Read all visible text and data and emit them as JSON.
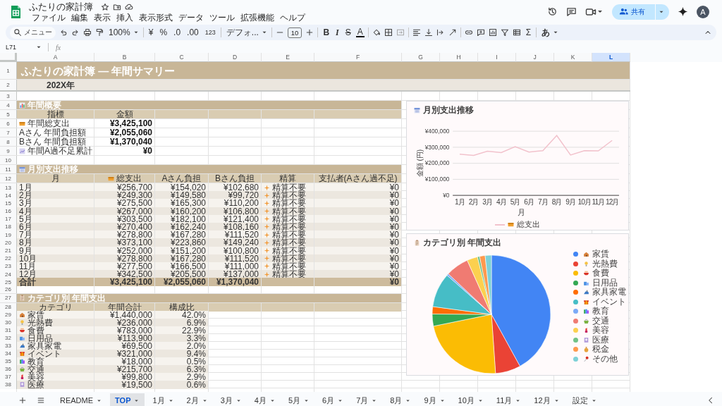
{
  "app": {
    "title": "ふたりの家計簿",
    "menu": [
      "ファイル",
      "編集",
      "表示",
      "挿入",
      "表示形式",
      "データ",
      "ツール",
      "拡張機能",
      "ヘルプ"
    ],
    "share": "共有",
    "avatar": "A"
  },
  "toolbar": {
    "search": "メニュー",
    "zoom": "100%",
    "currency": "¥",
    "percent": "%",
    "decrease_decimal": ".0",
    "increase_decimal": ".00",
    "number_format": "123",
    "font": "デフォ...",
    "font_size": "10",
    "bold": "B",
    "italic": "I",
    "strikethrough": "S",
    "text_color": "A",
    "functions": "Σ",
    "input_tools": "あ"
  },
  "formula_bar": {
    "cell": "L71",
    "fx": "fx"
  },
  "columns": [
    {
      "label": "A",
      "selected": false
    },
    {
      "label": "B",
      "selected": false
    },
    {
      "label": "C",
      "selected": false
    },
    {
      "label": "D",
      "selected": false
    },
    {
      "label": "E",
      "selected": false
    },
    {
      "label": "F",
      "selected": false
    },
    {
      "label": "G",
      "selected": false
    },
    {
      "label": "H",
      "selected": false
    },
    {
      "label": "I",
      "selected": false
    },
    {
      "label": "J",
      "selected": false
    },
    {
      "label": "K",
      "selected": false
    },
    {
      "label": "L",
      "selected": true
    }
  ],
  "row_numbers": [
    "1",
    "2",
    "3",
    "4",
    "5",
    "6",
    "7",
    "8",
    "9",
    "10",
    "11",
    "12",
    "13",
    "14",
    "15",
    "16",
    "17",
    "18",
    "19",
    "20",
    "21",
    "22",
    "23",
    "24",
    "25",
    "26",
    "27",
    "28",
    "29",
    "30",
    "31",
    "32",
    "33",
    "34",
    "35",
    "36",
    "37",
    "38"
  ],
  "sheet": {
    "title": "ふたりの家計簿 — 年間サマリー",
    "year": "202X年",
    "overview": {
      "title": "年間概要",
      "headers": [
        "指標",
        "金額"
      ],
      "items": [
        {
          "label": "年間総支出",
          "value": "¥3,425,100"
        },
        {
          "label": "Aさん 年間負担額",
          "value": "¥2,055,060"
        },
        {
          "label": "Bさん 年間負担額",
          "value": "¥1,370,040"
        },
        {
          "label": "年間A過不足累計",
          "value": "¥0"
        }
      ]
    },
    "monthly": {
      "title": "月別支出推移",
      "headers": [
        "月",
        "総支出",
        "Aさん負担",
        "Bさん負担",
        "精算",
        "支払者(Aさん過不足)"
      ],
      "rows": [
        {
          "month": "1月",
          "total": "¥256,700",
          "a": "¥154,020",
          "b": "¥102,680",
          "settlement": "精算不要",
          "payer": "¥0"
        },
        {
          "month": "2月",
          "total": "¥249,300",
          "a": "¥149,580",
          "b": "¥99,720",
          "settlement": "精算不要",
          "payer": "¥0"
        },
        {
          "month": "3月",
          "total": "¥275,500",
          "a": "¥165,300",
          "b": "¥110,200",
          "settlement": "精算不要",
          "payer": "¥0"
        },
        {
          "month": "4月",
          "total": "¥267,000",
          "a": "¥160,200",
          "b": "¥106,800",
          "settlement": "精算不要",
          "payer": "¥0"
        },
        {
          "month": "5月",
          "total": "¥303,500",
          "a": "¥182,100",
          "b": "¥121,400",
          "settlement": "精算不要",
          "payer": "¥0"
        },
        {
          "month": "6月",
          "total": "¥270,400",
          "a": "¥162,240",
          "b": "¥108,160",
          "settlement": "精算不要",
          "payer": "¥0"
        },
        {
          "month": "7月",
          "total": "¥278,800",
          "a": "¥167,280",
          "b": "¥111,520",
          "settlement": "精算不要",
          "payer": "¥0"
        },
        {
          "month": "8月",
          "total": "¥373,100",
          "a": "¥223,860",
          "b": "¥149,240",
          "settlement": "精算不要",
          "payer": "¥0"
        },
        {
          "month": "9月",
          "total": "¥252,000",
          "a": "¥151,200",
          "b": "¥100,800",
          "settlement": "精算不要",
          "payer": "¥0"
        },
        {
          "month": "10月",
          "total": "¥278,800",
          "a": "¥167,280",
          "b": "¥111,520",
          "settlement": "精算不要",
          "payer": "¥0"
        },
        {
          "month": "11月",
          "total": "¥277,500",
          "a": "¥166,500",
          "b": "¥111,000",
          "settlement": "精算不要",
          "payer": "¥0"
        },
        {
          "month": "12月",
          "total": "¥342,500",
          "a": "¥205,500",
          "b": "¥137,000",
          "settlement": "精算不要",
          "payer": "¥0"
        }
      ],
      "total_row": {
        "label": "合計",
        "total": "¥3,425,100",
        "a": "¥2,055,060",
        "b": "¥1,370,040",
        "payer": "¥0"
      }
    },
    "categories": {
      "title": "カテゴリ別 年間支出",
      "headers": [
        "カテゴリ",
        "年間合計",
        "構成比"
      ],
      "rows": [
        {
          "name": "家賃",
          "total": "¥1,440,000",
          "ratio": "42.0%"
        },
        {
          "name": "光熱費",
          "total": "¥236,000",
          "ratio": "6.9%"
        },
        {
          "name": "食費",
          "total": "¥783,000",
          "ratio": "22.9%"
        },
        {
          "name": "日用品",
          "total": "¥113,900",
          "ratio": "3.3%"
        },
        {
          "name": "家具家電",
          "total": "¥69,500",
          "ratio": "2.0%"
        },
        {
          "name": "イベント",
          "total": "¥321,000",
          "ratio": "9.4%"
        },
        {
          "name": "教育",
          "total": "¥18,000",
          "ratio": "0.5%"
        },
        {
          "name": "交通",
          "total": "¥215,700",
          "ratio": "6.3%"
        },
        {
          "name": "美容",
          "total": "¥99,800",
          "ratio": "2.9%"
        },
        {
          "name": "医療",
          "total": "¥19,500",
          "ratio": "0.6%"
        }
      ]
    }
  },
  "line_chart": {
    "title": "月別支出推移",
    "chart_data": {
      "type": "line",
      "xlabel": "月",
      "ylabel": "金額 (円)",
      "categories": [
        "1月",
        "2月",
        "3月",
        "4月",
        "5月",
        "6月",
        "7月",
        "8月",
        "9月",
        "10月",
        "11月",
        "12月"
      ],
      "series": [
        {
          "name": "総支出",
          "color": "#f2c2cc",
          "values": [
            256700,
            249300,
            275500,
            267000,
            303500,
            270400,
            278800,
            373100,
            252000,
            278800,
            277500,
            342500
          ]
        }
      ],
      "grid": true,
      "ylim": [
        0,
        400000
      ],
      "yticks": [
        {
          "value": 0,
          "label": "¥0"
        },
        {
          "value": 100000,
          "label": "¥100,000"
        },
        {
          "value": 200000,
          "label": "¥200,000"
        },
        {
          "value": 300000,
          "label": "¥300,000"
        },
        {
          "value": 400000,
          "label": "¥400,000"
        }
      ]
    }
  },
  "pie_chart": {
    "title": "カテゴリ別 年間支出",
    "chart_data": {
      "type": "pie",
      "categories": [
        "家賃",
        "光熱費",
        "食費",
        "日用品",
        "家具家電",
        "イベント",
        "教育",
        "交通",
        "美容",
        "医療",
        "税金",
        "その他"
      ],
      "series": [
        {
          "values": [
            42.0,
            6.9,
            22.9,
            3.3,
            2.0,
            9.4,
            0.5,
            6.3,
            2.9,
            0.6,
            1.5,
            1.7
          ]
        }
      ],
      "colors": [
        "#4285f4",
        "#ea4335",
        "#fbbc04",
        "#34a853",
        "#ff6d01",
        "#46bdc6",
        "#7baaf7",
        "#f07b72",
        "#fcd04f",
        "#71c287",
        "#ff994d",
        "#7ed1d7"
      ]
    }
  },
  "sheet_tabs": [
    {
      "label": "README",
      "selected": false
    },
    {
      "label": "TOP",
      "selected": true
    },
    {
      "label": "1月",
      "selected": false
    },
    {
      "label": "2月",
      "selected": false
    },
    {
      "label": "3月",
      "selected": false
    },
    {
      "label": "4月",
      "selected": false
    },
    {
      "label": "5月",
      "selected": false
    },
    {
      "label": "6月",
      "selected": false
    },
    {
      "label": "7月",
      "selected": false
    },
    {
      "label": "8月",
      "selected": false
    },
    {
      "label": "9月",
      "selected": false
    },
    {
      "label": "10月",
      "selected": false
    },
    {
      "label": "11月",
      "selected": false
    },
    {
      "label": "12月",
      "selected": false
    },
    {
      "label": "設定",
      "selected": false
    }
  ]
}
